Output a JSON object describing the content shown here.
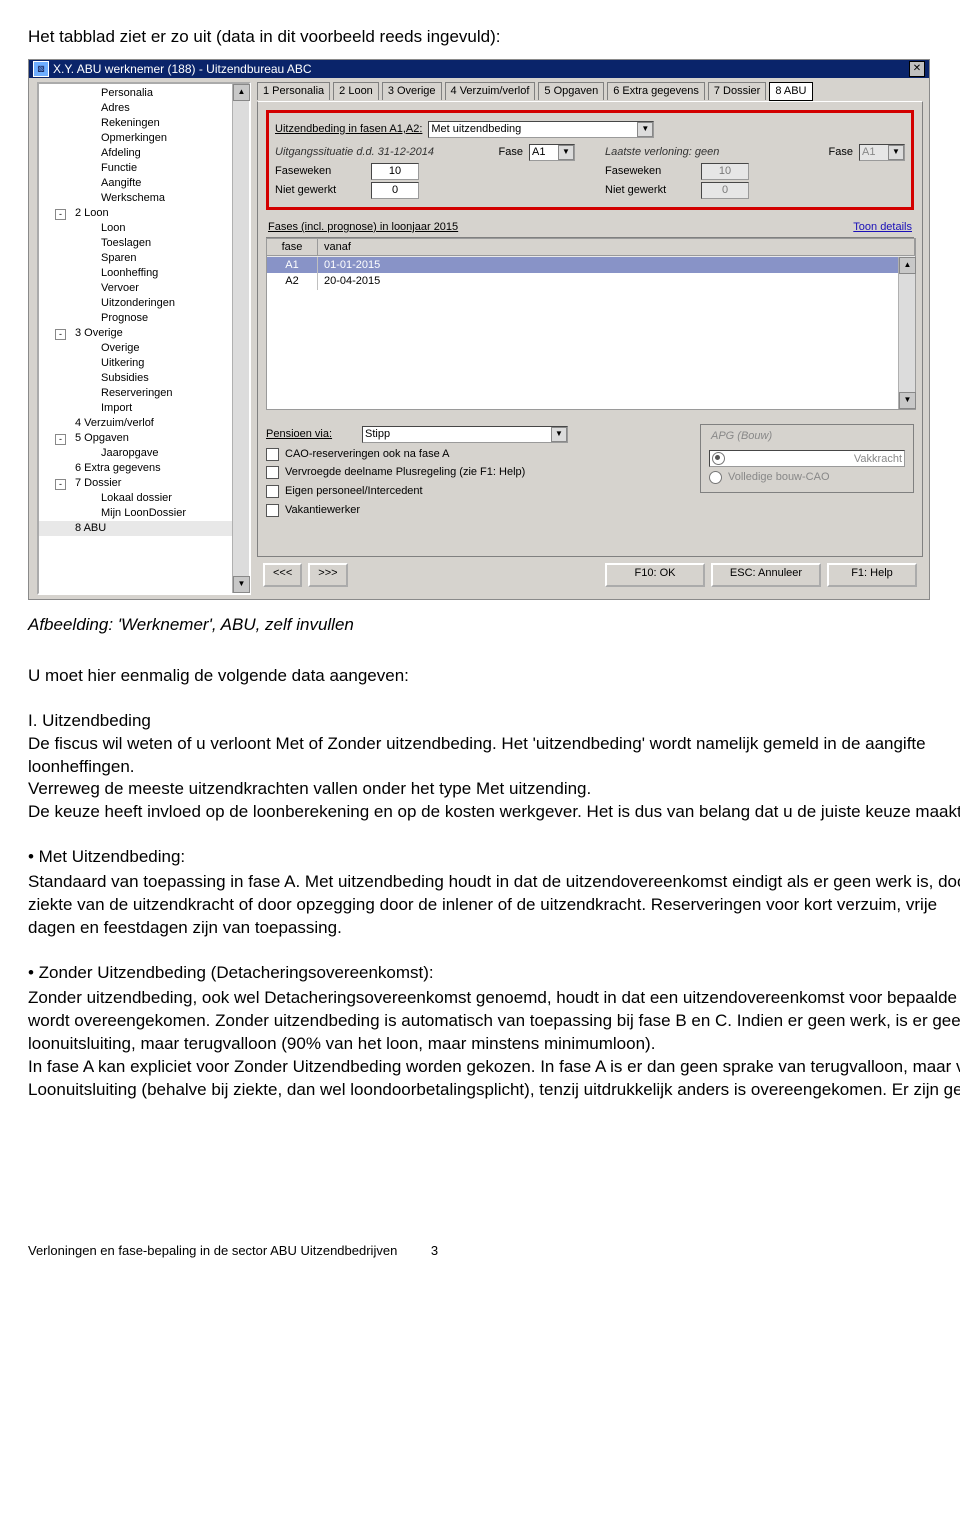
{
  "doc": {
    "intro": "Het tabblad ziet er zo uit (data in dit voorbeeld reeds ingevuld):",
    "caption": "Afbeelding: 'Werknemer', ABU, zelf invullen",
    "p1": "U moet hier eenmalig de volgende data aangeven:",
    "num1_title": "I. Uitzendbeding",
    "p2": "De fiscus wil weten of u verloont Met of Zonder uitzendbeding. Het 'uitzendbeding' wordt namelijk gemeld in de aangifte loonheffingen.",
    "p3": "Verreweg de meeste uitzendkrachten vallen onder het type Met uitzending.",
    "p3b": "De keuze heeft invloed op de loonberekening en op de kosten werkgever. Het is dus van belang dat u de juiste keuze maakt.",
    "b1": "• Met Uitzendbeding:",
    "p4": "Standaard van toepassing in fase A. Met uitzendbeding houdt in dat de uitzendovereenkomst eindigt als er geen werk is, door ziekte van de uitzendkracht of door opzegging door de inlener of de uitzendkracht. Reserveringen voor kort verzuim, vrije dagen en feestdagen zijn van toepassing.",
    "b2": "• Zonder Uitzendbeding (Detacheringsovereenkomst):",
    "p5": "Zonder uitzendbeding, ook wel Detacheringsovereenkomst genoemd, houdt in dat een uitzendovereenkomst voor bepaalde tijd wordt overeengekomen. Zonder uitzendbeding is automatisch van toepassing bij fase B en C. Indien er geen werk, is er geen loonuitsluiting, maar terugvalloon (90% van het loon, maar minstens minimumloon).",
    "p6": "In fase A kan expliciet voor Zonder Uitzendbeding worden gekozen. In fase A is er dan geen sprake van terugvalloon, maar van Loonuitsluiting (behalve bij ziekte, dan wel loondoorbetalingsplicht), tenzij uitdrukkelijk anders is overeengekomen. Er zijn geen",
    "footer": "Verloningen en fase-bepaling in de sector ABU Uitzendbedrijven",
    "pagenum": "3"
  },
  "shot": {
    "title": "X.Y. ABU werknemer (188) - Uitzendbureau ABC",
    "tree": [
      {
        "lvl": 2,
        "label": "Personalia"
      },
      {
        "lvl": 2,
        "label": "Adres"
      },
      {
        "lvl": 2,
        "label": "Rekeningen"
      },
      {
        "lvl": 2,
        "label": "Opmerkingen"
      },
      {
        "lvl": 2,
        "label": "Afdeling"
      },
      {
        "lvl": 2,
        "label": "Functie"
      },
      {
        "lvl": 2,
        "label": "Aangifte"
      },
      {
        "lvl": 2,
        "label": "Werkschema"
      },
      {
        "lvl": 1,
        "label": "2 Loon",
        "exp": "-"
      },
      {
        "lvl": 2,
        "label": "Loon"
      },
      {
        "lvl": 2,
        "label": "Toeslagen"
      },
      {
        "lvl": 2,
        "label": "Sparen"
      },
      {
        "lvl": 2,
        "label": "Loonheffing"
      },
      {
        "lvl": 2,
        "label": "Vervoer"
      },
      {
        "lvl": 2,
        "label": "Uitzonderingen"
      },
      {
        "lvl": 2,
        "label": "Prognose"
      },
      {
        "lvl": 1,
        "label": "3 Overige",
        "exp": "-"
      },
      {
        "lvl": 2,
        "label": "Overige"
      },
      {
        "lvl": 2,
        "label": "Uitkering"
      },
      {
        "lvl": 2,
        "label": "Subsidies"
      },
      {
        "lvl": 2,
        "label": "Reserveringen"
      },
      {
        "lvl": 2,
        "label": "Import"
      },
      {
        "lvl": 1,
        "label": "4 Verzuim/verlof"
      },
      {
        "lvl": 1,
        "label": "5 Opgaven",
        "exp": "-"
      },
      {
        "lvl": 2,
        "label": "Jaaropgave"
      },
      {
        "lvl": 1,
        "label": "6 Extra gegevens"
      },
      {
        "lvl": 1,
        "label": "7 Dossier",
        "exp": "-"
      },
      {
        "lvl": 2,
        "label": "Lokaal dossier"
      },
      {
        "lvl": 2,
        "label": "Mijn LoonDossier"
      },
      {
        "lvl": 1,
        "label": "8 ABU",
        "active": true
      }
    ],
    "tabs": [
      "1 Personalia",
      "2 Loon",
      "3 Overige",
      "4 Verzuim/verlof",
      "5 Opgaven",
      "6 Extra gegevens",
      "7 Dossier",
      "8 ABU"
    ],
    "activeTab": "8 ABU",
    "red": {
      "lbl_uit_fasen": "Uitzendbeding in fasen A1,A2:",
      "val_uit": "Met uitzendbeding",
      "lbl_uitgang": "Uitgangssituatie d.d. 31-12-2014",
      "lbl_fase": "Fase",
      "fase_left": "A1",
      "lbl_laatste": "Laatste verloning: geen",
      "fase_right": "A1",
      "lbl_fasewk": "Faseweken",
      "fasewk_l": "10",
      "fasewk_r": "10",
      "lbl_niet": "Niet gewerkt",
      "niet_l": "0",
      "niet_r": "0"
    },
    "sub": {
      "title": "Fases (incl. prognose) in loonjaar 2015",
      "link": "Toon details"
    },
    "grid": {
      "h1": "fase",
      "h2": "vanaf",
      "rows": [
        {
          "c1": "A1",
          "c2": "01-01-2015",
          "sel": true
        },
        {
          "c1": "A2",
          "c2": "20-04-2015"
        }
      ]
    },
    "pensioen": {
      "lbl": "Pensioen via:",
      "val": "Stipp",
      "chk1": "CAO-reserveringen ook na fase A",
      "chk2": "Vervroegde deelname Plusregeling (zie F1: Help)",
      "chk3": "Eigen personeel/Intercedent",
      "chk4": "Vakantiewerker",
      "rbtitle": "APG (Bouw)",
      "radio1": "Vakkracht",
      "radio2": "Volledige bouw-CAO"
    },
    "footbtns": {
      "prev": "<<<",
      "next": ">>>",
      "ok": "F10: OK",
      "cancel": "ESC: Annuleer",
      "help": "F1: Help"
    }
  }
}
